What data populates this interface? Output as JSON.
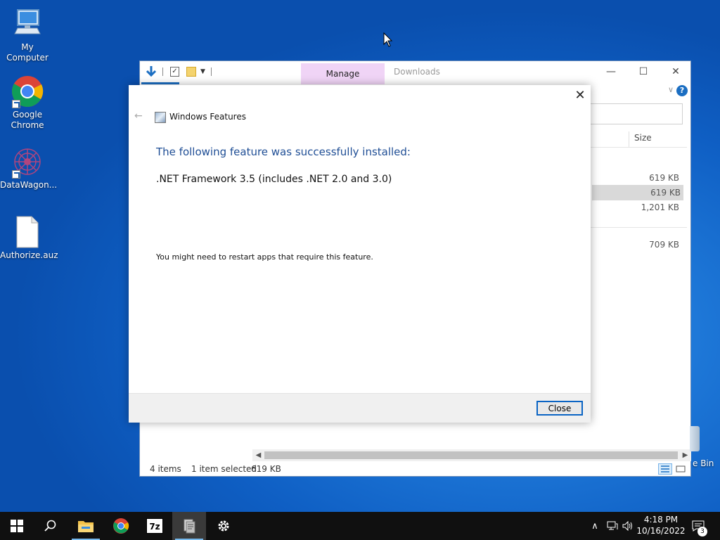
{
  "desktop": {
    "icons": [
      {
        "label": "My Computer",
        "icon": "computer-icon"
      },
      {
        "label": "Google Chrome",
        "icon": "chrome-icon"
      },
      {
        "label": "DataWagon...",
        "icon": "datawagon-icon"
      },
      {
        "label": "Authorize.auz",
        "icon": "file-icon"
      }
    ],
    "recycle_bin_partial_label": "e Bin"
  },
  "explorer": {
    "title": "Downloads",
    "context_tab": "Manage",
    "column_size_header": "Size",
    "sizes": [
      "619 KB",
      "619 KB",
      "1,201 KB",
      "709 KB"
    ],
    "selected_row_index": 1,
    "status": {
      "item_count": "4 items",
      "selection": "1 item selected",
      "selection_size": "619 KB"
    }
  },
  "dialog": {
    "app_title": "Windows Features",
    "heading": "The following feature was successfully installed:",
    "feature": ".NET Framework 3.5 (includes .NET 2.0 and 3.0)",
    "note": "You might need to restart apps that require this feature.",
    "close_button": "Close"
  },
  "taskbar": {
    "pinned": [
      "start-icon",
      "search-icon",
      "file-explorer-icon",
      "chrome-icon",
      "7zip-icon",
      "windows-features-icon",
      "settings-icon"
    ],
    "app_7zip_label": "7z",
    "active_item": "windows-features-icon",
    "clock": {
      "time": "4:18 PM",
      "date": "10/16/2022"
    },
    "notification_count": "3"
  },
  "colors": {
    "accent": "#0a64c4",
    "heading_blue": "#1f4e95",
    "manage_tab": "#f0d4f6",
    "selection_gray": "#d9d9d9"
  }
}
